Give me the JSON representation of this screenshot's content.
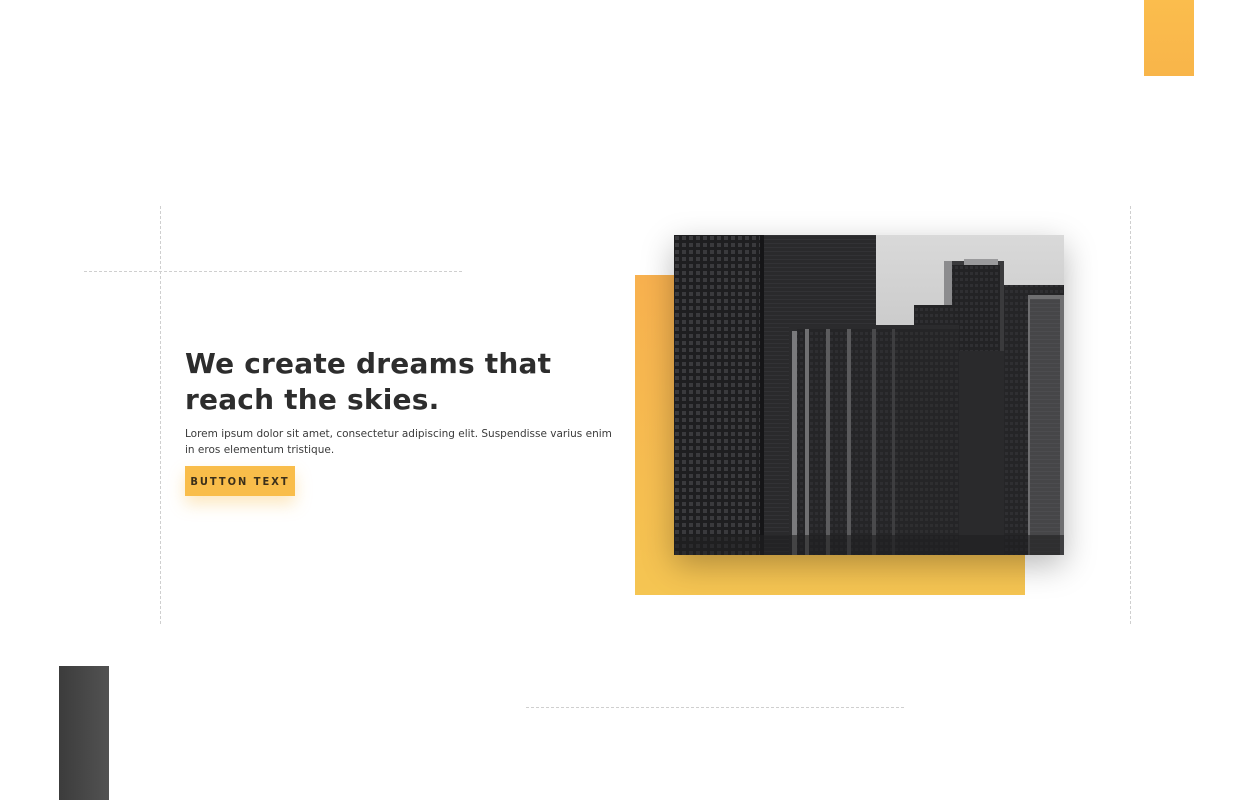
{
  "hero": {
    "title": "We create dreams that reach the skies.",
    "body": "Lorem ipsum dolor sit amet, consectetur adipiscing elit. Suspendisse varius enim in eros elementum tristique.",
    "button_label": "BUTTON TEXT"
  },
  "colors": {
    "accent": "#f9bd4a",
    "heading": "#2d2d2d",
    "dark_block": "#4a4a4a"
  }
}
